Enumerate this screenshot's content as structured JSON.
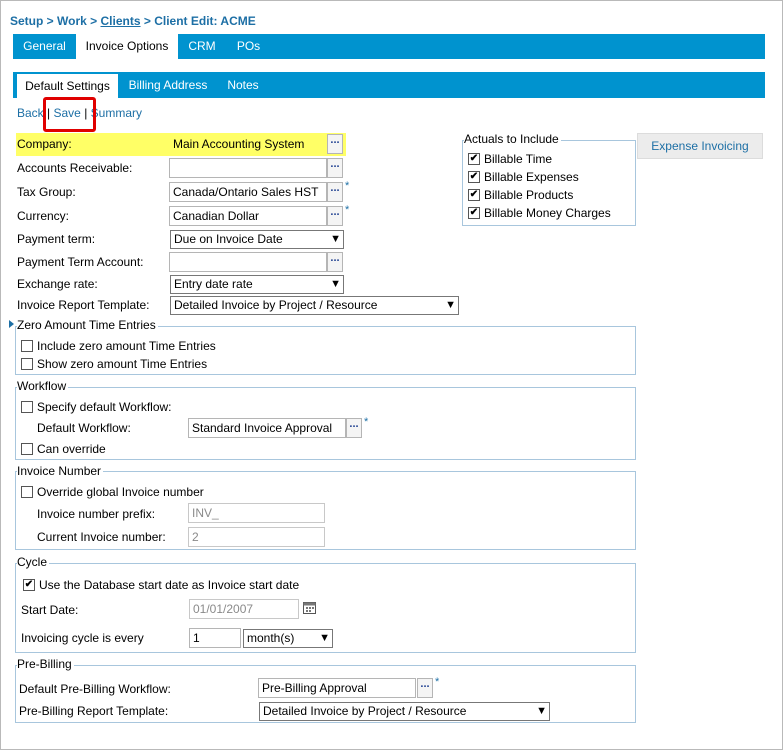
{
  "breadcrumb": {
    "setup": "Setup",
    "sep1": " > ",
    "work": "Work",
    "sep2": " > ",
    "clients": "Clients",
    "sep3": " > ",
    "current": "Client Edit: ACME"
  },
  "top_tabs": [
    "General",
    "Invoice Options",
    "CRM",
    "POs"
  ],
  "sub_tabs": [
    "Default Settings",
    "Billing Address",
    "Notes"
  ],
  "actions": {
    "back": "Back",
    "sep1": "|",
    "save": "Save",
    "sep2": "|",
    "summary": "Summary"
  },
  "form": {
    "company": {
      "label": "Company:",
      "value": "Main Accounting System"
    },
    "ar": {
      "label": "Accounts Receivable:",
      "value": ""
    },
    "tax_group": {
      "label": "Tax Group:",
      "value": "Canada/Ontario Sales HST"
    },
    "currency": {
      "label": "Currency:",
      "value": "Canadian Dollar"
    },
    "payment_term": {
      "label": "Payment term:",
      "value": "Due on Invoice Date"
    },
    "payment_term_account": {
      "label": "Payment Term Account:",
      "value": ""
    },
    "exchange_rate": {
      "label": "Exchange rate:",
      "value": "Entry date rate"
    },
    "report_template": {
      "label": "Invoice Report Template:",
      "value": "Detailed Invoice by Project / Resource"
    }
  },
  "lookup_glyph": "...",
  "required_mark": "*",
  "actuals": {
    "legend": "Actuals to Include",
    "items": [
      {
        "label": "Billable Time",
        "checked": true
      },
      {
        "label": "Billable Expenses",
        "checked": true
      },
      {
        "label": "Billable Products",
        "checked": true
      },
      {
        "label": "Billable Money Charges",
        "checked": true
      }
    ]
  },
  "check_glyph": "✔",
  "expense_button": "Expense Invoicing",
  "zero_amount": {
    "legend": "Zero Amount Time Entries",
    "include": "Include zero amount Time Entries",
    "show": "Show zero amount Time Entries"
  },
  "workflow": {
    "legend": "Workflow",
    "specify": "Specify default Workflow:",
    "default_label": "Default Workflow:",
    "default_value": "Standard Invoice Approval",
    "can_override": "Can override"
  },
  "invoice_number": {
    "legend": "Invoice Number",
    "override": "Override global Invoice number",
    "prefix_label": "Invoice number prefix:",
    "prefix_value": "INV_",
    "current_label": "Current Invoice number:",
    "current_value": "2"
  },
  "cycle": {
    "legend": "Cycle",
    "use_db": "Use the Database start date as Invoice start date",
    "start_label": "Start Date:",
    "start_value": "01/01/2007",
    "every_label": "Invoicing cycle is every",
    "every_value": "1",
    "unit": "month(s)"
  },
  "prebilling": {
    "legend": "Pre-Billing",
    "workflow_label": "Default Pre-Billing Workflow:",
    "workflow_value": "Pre-Billing Approval",
    "report_label": "Pre-Billing Report Template:",
    "report_value": "Detailed Invoice by Project / Resource"
  },
  "colors": {
    "tab_bar": "#0093cf",
    "highlight": "#ffff66",
    "annotation": "#e00000",
    "link": "#1d6fa5"
  }
}
